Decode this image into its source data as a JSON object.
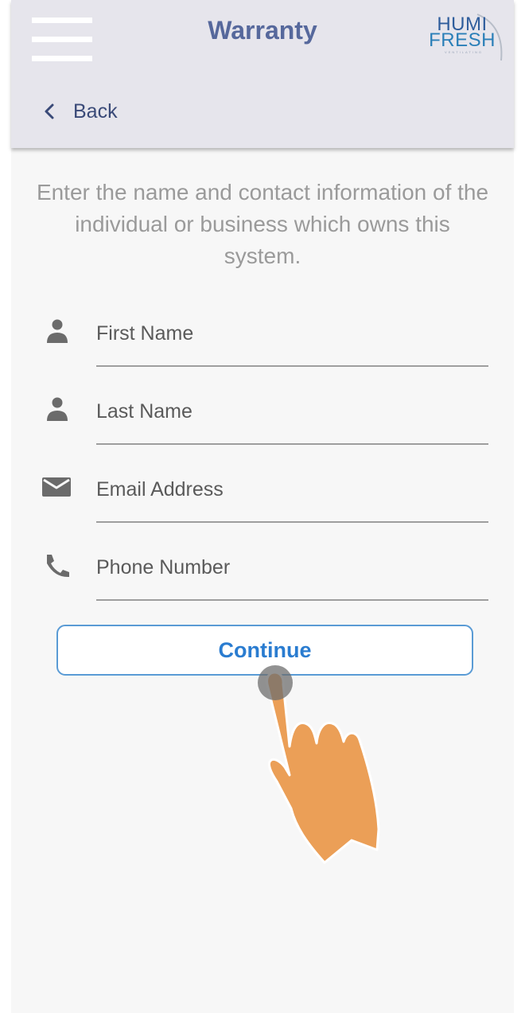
{
  "header": {
    "title": "Warranty",
    "menu_icon": "hamburger-menu-icon",
    "back_label": "Back",
    "back_icon": "chevron-left-icon",
    "logo": {
      "line1": "HUMI",
      "line2": "FRESH",
      "tagline": "VENTILATING"
    }
  },
  "intro_text": "Enter the name and contact information of the individual or business which owns this system.",
  "form": {
    "first_name": {
      "placeholder": "First Name",
      "value": "",
      "icon": "person-icon"
    },
    "last_name": {
      "placeholder": "Last Name",
      "value": "",
      "icon": "person-icon"
    },
    "email": {
      "placeholder": "Email Address",
      "value": "",
      "icon": "envelope-icon"
    },
    "phone": {
      "placeholder": "Phone Number",
      "value": "",
      "icon": "phone-icon"
    }
  },
  "continue_label": "Continue",
  "colors": {
    "header_bg": "#e6e5ec",
    "title": "#56689c",
    "accent": "#2a7cd0",
    "button_border": "#5a9bd5",
    "hand": "#eb9f57"
  }
}
